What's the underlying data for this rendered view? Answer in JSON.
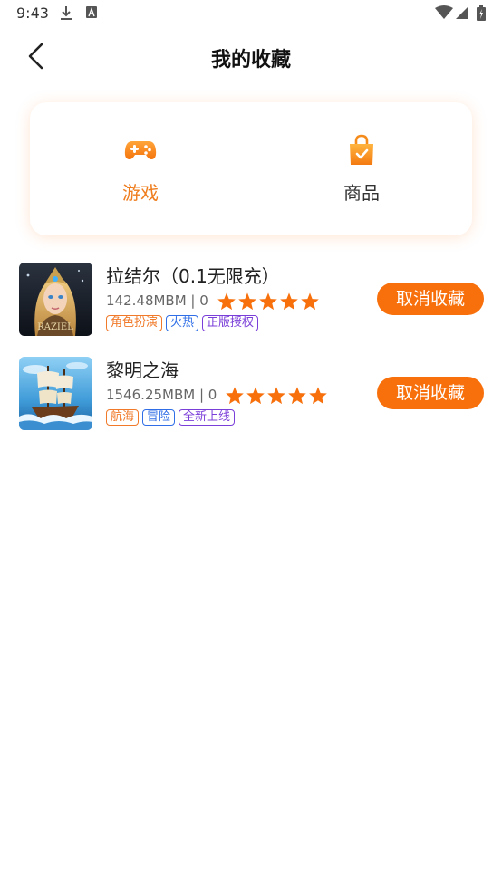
{
  "status_bar": {
    "time": "9:43"
  },
  "header": {
    "title": "我的收藏"
  },
  "tabs": [
    {
      "label": "游戏",
      "icon": "gamepad-icon",
      "active": true
    },
    {
      "label": "商品",
      "icon": "shopping-bag-icon",
      "active": false
    }
  ],
  "colors": {
    "accent": "#f7700c",
    "active_tab": "#ef7d1e",
    "star": "#f7700c",
    "tag_orange": "#f07a2a",
    "tag_blue": "#2f6ee6",
    "tag_purple": "#7b3fd9"
  },
  "games": [
    {
      "name": "拉结尔（0.1无限充）",
      "meta": "142.48MBM | 0",
      "rating": 5,
      "tags": [
        "角色扮演",
        "火热",
        "正版授权"
      ],
      "thumb_text": "RAZIEL",
      "action": "取消收藏"
    },
    {
      "name": "黎明之海",
      "meta": "1546.25MBM | 0",
      "rating": 5,
      "tags": [
        "航海",
        "冒险",
        "全新上线"
      ],
      "action": "取消收藏"
    }
  ]
}
